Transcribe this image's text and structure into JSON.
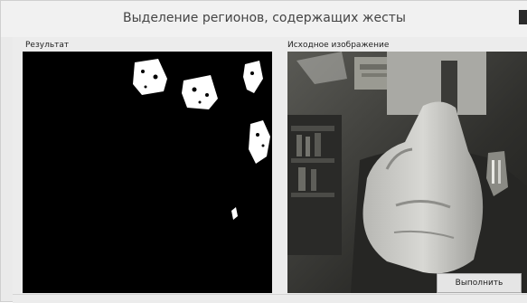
{
  "window": {
    "title": "Выделение регионов, содержащих жесты"
  },
  "panels": {
    "result_label": "Результат",
    "source_label": "Исходное изображение"
  },
  "actions": {
    "run_label": "Выполнить"
  },
  "colors": {
    "window_bg": "#eaeaea",
    "titlebar_bg": "#f1f1f1",
    "result_bg": "#000000",
    "blob_fg": "#ffffff"
  }
}
